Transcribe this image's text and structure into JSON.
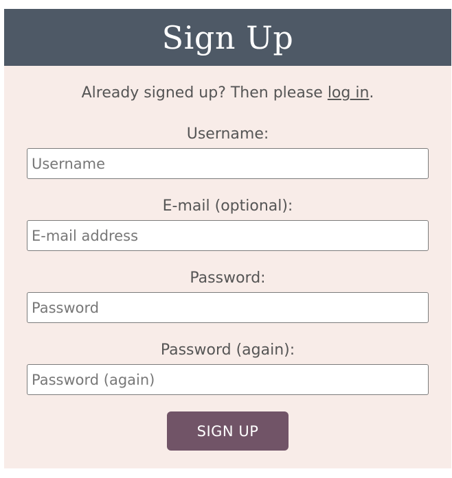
{
  "header": {
    "title": "Sign Up"
  },
  "intro": {
    "text_before": "Already signed up? Then please ",
    "link_text": "log in",
    "text_after": "."
  },
  "form": {
    "fields": [
      {
        "label": "Username:",
        "placeholder": "Username",
        "value": ""
      },
      {
        "label": "E-mail (optional):",
        "placeholder": "E-mail address",
        "value": ""
      },
      {
        "label": "Password:",
        "placeholder": "Password",
        "value": ""
      },
      {
        "label": "Password (again):",
        "placeholder": "Password (again)",
        "value": ""
      }
    ],
    "submit_label": "SIGN UP"
  },
  "colors": {
    "header_bg": "#4e5966",
    "card_bg": "#f8ece8",
    "button_bg": "#715467",
    "text": "#555555"
  }
}
